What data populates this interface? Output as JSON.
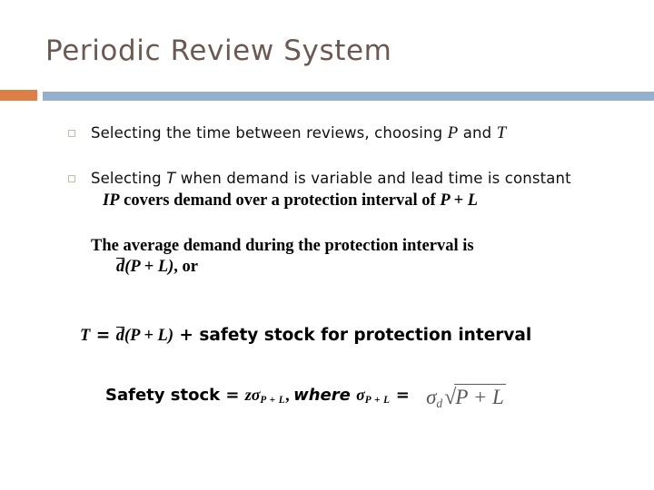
{
  "slide": {
    "title": "Periodic Review System",
    "accent_orange": "#DD8047",
    "accent_blue": "#94B0CD",
    "title_color": "#6B5A52",
    "bullet_color": "#C9B9A0"
  },
  "bullets": [
    {
      "text_before": "Selecting the time between reviews, choosing ",
      "sym1": "P",
      "text_mid": " and ",
      "sym2": "T"
    },
    {
      "text_before": "Selecting ",
      "sym1": "T",
      "text_mid": " when demand is variable and lead time is constant"
    }
  ],
  "lines": {
    "ip_line": {
      "lead": "IP",
      "body": " covers demand over a protection interval of ",
      "expr": "P + L"
    },
    "avg_line_1": "The average demand during the protection interval is",
    "avg_line_2": {
      "dbar": "d",
      "expr": "(P + L)",
      "tail": ", or"
    },
    "t_line": {
      "lhs": "T",
      "eq": " = ",
      "dbar": "d",
      "expr": "(P + L)",
      "plus": " + safety stock for protection interval"
    },
    "ss_line": {
      "label": "Safety stock = ",
      "z": "z",
      "sigma": "σ",
      "sub1": "P + L",
      "comma": ", ",
      "where": "where ",
      "sigma2": "σ",
      "sub2": "P + L",
      "equals": " = "
    },
    "equation_object": {
      "sigma": "σ",
      "sigma_sub": "d",
      "radical_sign": "√",
      "radicand": "P + L"
    }
  }
}
